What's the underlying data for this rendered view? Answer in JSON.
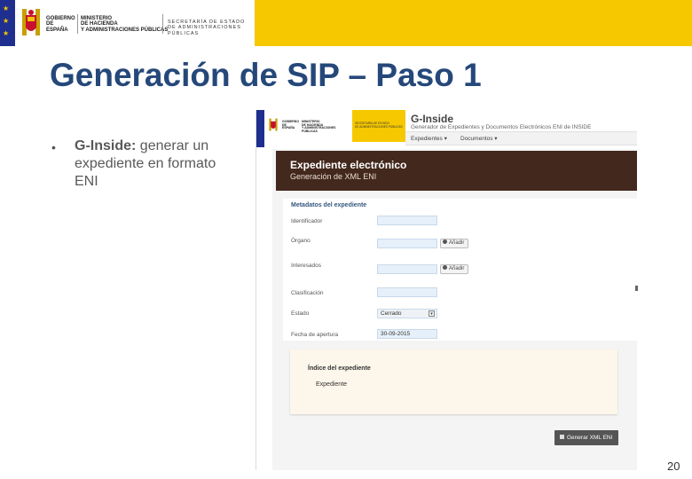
{
  "banner": {
    "gobierno": "GOBIERNO DE ESPAÑA",
    "ministerio": [
      "MINISTERIO",
      "DE HACIENDA",
      "Y ADMINISTRACIONES PÚBLICAS"
    ],
    "secretaria": [
      "SECRETARÍA DE ESTADO",
      "DE ADMINISTRACIONES PÚBLICAS"
    ],
    "color": "#f6c800"
  },
  "slide": {
    "title": "Generación de SIP – Paso 1",
    "bullet_bold": "G-Inside:",
    "bullet_rest": " generar un expediente en formato ENI",
    "page_number": "20"
  },
  "screenshot": {
    "app_title": "G-Inside",
    "app_subtitle": "Generador de Expedientes y Documentos Electrónicos ENI de INSIDE",
    "nav": [
      "Expedientes ▾",
      "Documentos ▾"
    ],
    "header_title": "Expediente electrónico",
    "header_subtitle": "Generación de XML ENI",
    "metadata_title": "Metadatos del expediente",
    "fields": [
      {
        "label": "Identificador",
        "value": ""
      },
      {
        "label": "Órgano",
        "value": ""
      },
      {
        "label": "Interesados",
        "value": ""
      },
      {
        "label": "Clasificación",
        "value": ""
      },
      {
        "label": "Estado",
        "value": "Cerrado"
      },
      {
        "label": "Fecha de apertura",
        "value": "30-09-2015"
      }
    ],
    "add_button": "Añadir",
    "index_title": "Índice del expediente",
    "index_item": "Expediente",
    "generate_button": "Generar XML ENI",
    "header_color": "#43281d"
  }
}
